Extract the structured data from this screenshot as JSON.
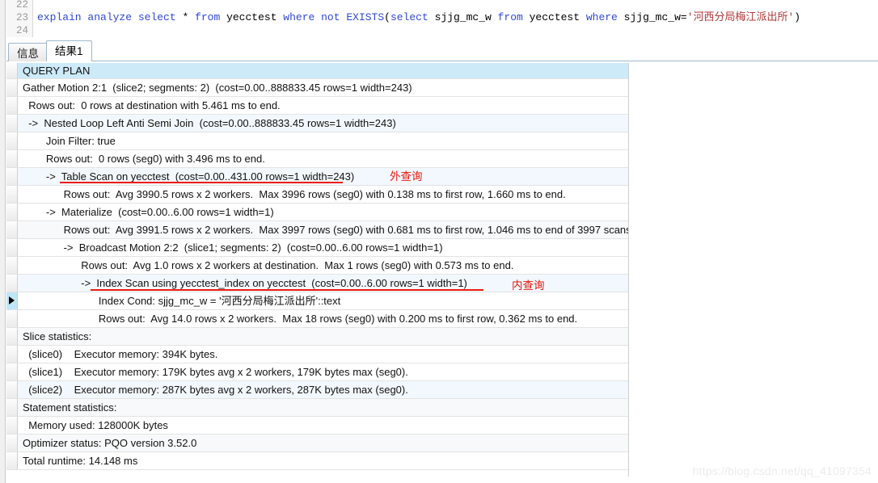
{
  "editor": {
    "line_numbers": [
      "22",
      "23",
      "24"
    ],
    "sql_tokens": [
      {
        "t": "explain",
        "c": "kw"
      },
      {
        "t": " ",
        "c": "plain"
      },
      {
        "t": "analyze",
        "c": "kw"
      },
      {
        "t": " ",
        "c": "plain"
      },
      {
        "t": "select",
        "c": "kw"
      },
      {
        "t": " * ",
        "c": "plain"
      },
      {
        "t": "from",
        "c": "kw"
      },
      {
        "t": " yecctest ",
        "c": "plain"
      },
      {
        "t": "where",
        "c": "kw"
      },
      {
        "t": " ",
        "c": "plain"
      },
      {
        "t": "not",
        "c": "kw"
      },
      {
        "t": " ",
        "c": "plain"
      },
      {
        "t": "EXISTS",
        "c": "kw"
      },
      {
        "t": "(",
        "c": "plain"
      },
      {
        "t": "select",
        "c": "kw"
      },
      {
        "t": " sjjg_mc_w ",
        "c": "plain"
      },
      {
        "t": "from",
        "c": "kw"
      },
      {
        "t": " yecctest ",
        "c": "plain"
      },
      {
        "t": "where",
        "c": "kw"
      },
      {
        "t": " sjjg_mc_w=",
        "c": "plain"
      },
      {
        "t": "'河西分局梅江派出所'",
        "c": "str"
      },
      {
        "t": ")",
        "c": "plain"
      }
    ],
    "sql_plain": "explain analyze select * from yecctest where not EXISTS(select sjjg_mc_w from yecctest where sjjg_mc_w='河西分局梅江派出所')"
  },
  "tabs": [
    {
      "label": "信息",
      "active": false
    },
    {
      "label": "结果1",
      "active": true
    }
  ],
  "grid": {
    "column_header": "QUERY PLAN",
    "rows": [
      "Gather Motion 2:1  (slice2; segments: 2)  (cost=0.00..888833.45 rows=1 width=243)",
      "  Rows out:  0 rows at destination with 5.461 ms to end.",
      "  ->  Nested Loop Left Anti Semi Join  (cost=0.00..888833.45 rows=1 width=243)",
      "        Join Filter: true",
      "        Rows out:  0 rows (seg0) with 3.496 ms to end.",
      "        ->  Table Scan on yecctest  (cost=0.00..431.00 rows=1 width=243)",
      "              Rows out:  Avg 3990.5 rows x 2 workers.  Max 3996 rows (seg0) with 0.138 ms to first row, 1.660 ms to end.",
      "        ->  Materialize  (cost=0.00..6.00 rows=1 width=1)",
      "              Rows out:  Avg 3991.5 rows x 2 workers.  Max 3997 rows (seg0) with 0.681 ms to first row, 1.046 ms to end of 3997 scans.",
      "              ->  Broadcast Motion 2:2  (slice1; segments: 2)  (cost=0.00..6.00 rows=1 width=1)",
      "                    Rows out:  Avg 1.0 rows x 2 workers at destination.  Max 1 rows (seg0) with 0.573 ms to end.",
      "                    ->  Index Scan using yecctest_index on yecctest  (cost=0.00..6.00 rows=1 width=1)",
      "                          Index Cond: sjjg_mc_w = '河西分局梅江派出所'::text",
      "                          Rows out:  Avg 14.0 rows x 2 workers.  Max 18 rows (seg0) with 0.200 ms to first row, 0.362 ms to end.",
      "Slice statistics:",
      "  (slice0)    Executor memory: 394K bytes.",
      "  (slice1)    Executor memory: 179K bytes avg x 2 workers, 179K bytes max (seg0).",
      "  (slice2)    Executor memory: 287K bytes avg x 2 workers, 287K bytes max (seg0).",
      "Statement statistics:",
      "  Memory used: 128000K bytes",
      "Optimizer status: PQO version 3.52.0",
      "Total runtime: 14.148 ms"
    ],
    "current_row_index": 12
  },
  "annotations": [
    {
      "label": "外查询",
      "note": "outer-query"
    },
    {
      "label": "内查询",
      "note": "inner-query"
    }
  ],
  "watermark": "https://blog.csdn.net/qq_41097354",
  "colors": {
    "header_bg": "#cdeaf8",
    "annotation_red": "#e8160c",
    "underline_red": "#ee1c10",
    "keyword_blue": "#2f47d6",
    "string_red": "#b03a3a"
  }
}
